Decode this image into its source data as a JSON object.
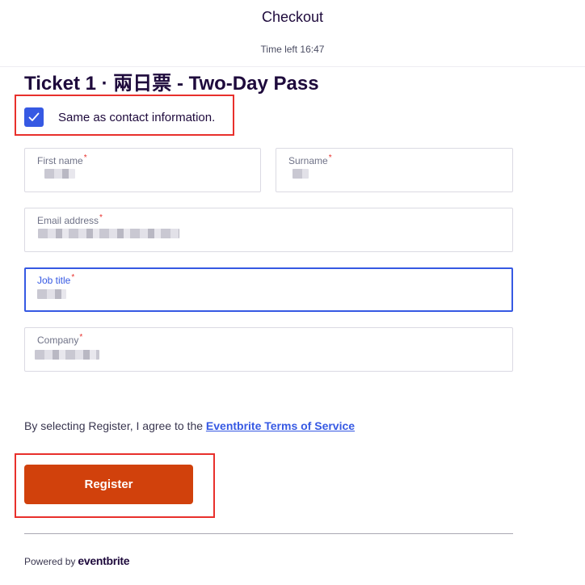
{
  "header": {
    "title": "Checkout",
    "time_left": "Time left 16:47"
  },
  "ticket": {
    "title": "Ticket 1 · 兩日票 - Two-Day Pass"
  },
  "same_as_contact": {
    "label": "Same as contact information.",
    "checked": true
  },
  "fields": {
    "first_name": {
      "label": "First name",
      "required": "*"
    },
    "surname": {
      "label": "Surname",
      "required": "*"
    },
    "email": {
      "label": "Email address",
      "required": "*"
    },
    "job_title": {
      "label": "Job title",
      "required": "*"
    },
    "company": {
      "label": "Company",
      "required": "*"
    }
  },
  "agreement": {
    "text": "By selecting Register, I agree to the ",
    "link": "Eventbrite Terms of Service"
  },
  "register_button": {
    "label": "Register"
  },
  "footer": {
    "powered_by": "Powered by",
    "logo": "eventbrite"
  },
  "colors": {
    "accent": "#3659e3",
    "button": "#d1410c",
    "highlight": "#e8302c"
  }
}
